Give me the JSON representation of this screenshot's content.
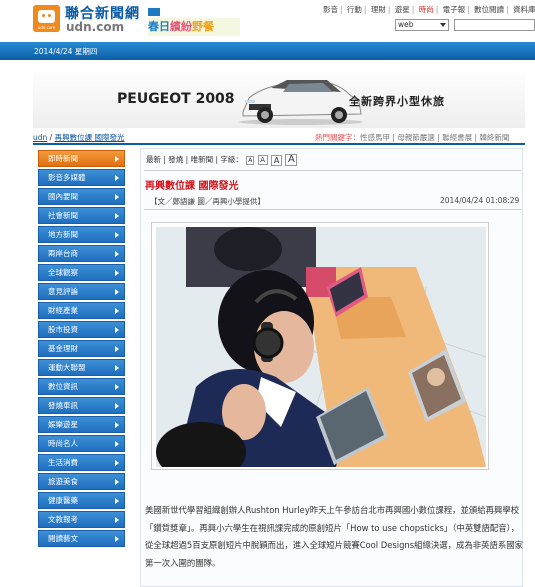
{
  "header": {
    "logo_title": "聯合新聞網",
    "logo_domain": "udn.com",
    "logo_sub": "udn.com",
    "promo": {
      "part1": "春日",
      "part2": "繽紛",
      "part3": "野餐"
    },
    "topnav": [
      "影音",
      "行動",
      "理財",
      "遊星",
      "時尚",
      "電子報",
      "數位閱讀",
      "資料庫",
      "閱"
    ],
    "search_select": "web"
  },
  "datebar": {
    "date": "2014/4/24 星期四"
  },
  "ad": {
    "brand": "PEUGEOT 2008",
    "slogan": "全新跨界小型休旅"
  },
  "breadcrumb": {
    "home": "udn",
    "sep": " / ",
    "current": "再興數位課 國際發光"
  },
  "hotwords": {
    "label": "熱門關鍵字：",
    "items": [
      "性感馬甲",
      "母親節嚴選",
      "聯經書展",
      "韓終新聞"
    ]
  },
  "sidebar": {
    "items": [
      {
        "label": "即時新聞",
        "active": true
      },
      {
        "label": "影音多媒體",
        "active": false
      },
      {
        "label": "國內要聞",
        "active": false
      },
      {
        "label": "社會新聞",
        "active": false
      },
      {
        "label": "地方新聞",
        "active": false
      },
      {
        "label": "兩岸台商",
        "active": false
      },
      {
        "label": "全球觀察",
        "active": false
      },
      {
        "label": "意見評論",
        "active": false
      },
      {
        "label": "財經產業",
        "active": false
      },
      {
        "label": "股市投資",
        "active": false
      },
      {
        "label": "基金理財",
        "active": false
      },
      {
        "label": "運動大聯盟",
        "active": false
      },
      {
        "label": "數位資訊",
        "active": false
      },
      {
        "label": "發燒車訊",
        "active": false
      },
      {
        "label": "娛樂遊星",
        "active": false
      },
      {
        "label": "時尚名人",
        "active": false
      },
      {
        "label": "生活消費",
        "active": false
      },
      {
        "label": "旅遊美食",
        "active": false
      },
      {
        "label": "健康醫藥",
        "active": false
      },
      {
        "label": "文教報考",
        "active": false
      },
      {
        "label": "閱讀藝文",
        "active": false
      }
    ]
  },
  "article": {
    "toolbar": {
      "links": "最新 | 發燒 | 唯新聞 | 字級：",
      "font_small": "A",
      "font_mid": "A",
      "font_large": "A",
      "font_xlarge": "A"
    },
    "title": "再興數位課 國際發光",
    "byline": "【文／鄭語謙 圖／再興小學提供】",
    "timestamp": "2014/04/24 01:08:29",
    "body": "美國新世代學習組織創辦人Rushton Hurley昨天上午參訪台北市再興國小數位課程，並頒給再興學校「鑽質獎章」。再興小六學生在視訊課完成的原創短片「How to use chopsticks」（中英雙語配音），從全球超過5百支原創短片中脫穎而出，進入全球短片競賽Cool Designs組總決選，成為非英語系國家第一次入圍的團隊。"
  },
  "colors": {
    "brand_blue": "#0b5ea6",
    "active_orange": "#e26f12",
    "title_red": "#d2161e",
    "hot_red": "#d22222"
  }
}
